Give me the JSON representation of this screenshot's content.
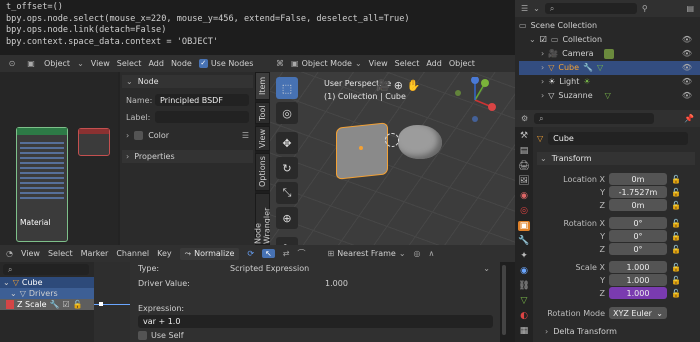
{
  "console": {
    "lines": [
      "t_offset=()",
      "bpy.ops.node.select(mouse_x=220, mouse_y=456, extend=False, deselect_all=True)",
      "bpy.ops.node.link(detach=False)",
      "bpy.context.space_data.context = 'OBJECT'"
    ]
  },
  "node_editor": {
    "header": {
      "object_mode": "Object",
      "menu": [
        "View",
        "Select",
        "Add",
        "Node"
      ],
      "use_nodes": "Use Nodes"
    },
    "panel_title": "Node",
    "name_label": "Name:",
    "name_value": "Principled BSDF",
    "label_label": "Label:",
    "color_label": "Color",
    "properties_label": "Properties",
    "tabs": [
      "Item",
      "Tool",
      "View",
      "Options",
      "Node Wrangler"
    ],
    "material_label": "Material"
  },
  "viewport": {
    "mode": "Object Mode",
    "menu": [
      "View",
      "Select",
      "Add",
      "Object"
    ],
    "overlay_title": "User Perspective",
    "overlay_sub": "(1) Collection | Cube"
  },
  "outliner": {
    "items": [
      {
        "label": "Scene Collection"
      },
      {
        "label": "Collection"
      },
      {
        "label": "Camera"
      },
      {
        "label": "Cube"
      },
      {
        "label": "Light"
      },
      {
        "label": "Suzanne"
      }
    ]
  },
  "properties": {
    "object_name": "Cube",
    "transform_title": "Transform",
    "location": {
      "label": "Location X",
      "y": "Y",
      "z": "Z",
      "x_val": "0m",
      "y_val": "-1.7527m",
      "z_val": "0m"
    },
    "rotation": {
      "label": "Rotation X",
      "y": "Y",
      "z": "Z",
      "x_val": "0°",
      "y_val": "0°",
      "z_val": "0°"
    },
    "scale": {
      "label": "Scale X",
      "y": "Y",
      "z": "Z",
      "x_val": "1.000",
      "y_val": "1.000",
      "z_val": "1.000"
    },
    "rotation_mode_label": "Rotation Mode",
    "rotation_mode_value": "XYZ Euler",
    "delta_label": "Delta Transform"
  },
  "drivers": {
    "menu": [
      "View",
      "Select",
      "Marker",
      "Channel",
      "Key"
    ],
    "normalize": "Normalize",
    "interp": "Nearest Frame",
    "tree": [
      "Cube",
      "Drivers",
      "Z Scale"
    ],
    "type_label": "Type:",
    "type_value": "Scripted Expression",
    "driver_value_label": "Driver Value:",
    "driver_value": "1.000",
    "expression_label": "Expression:",
    "expression_value": "var + 1.0",
    "use_self": "Use Self"
  }
}
